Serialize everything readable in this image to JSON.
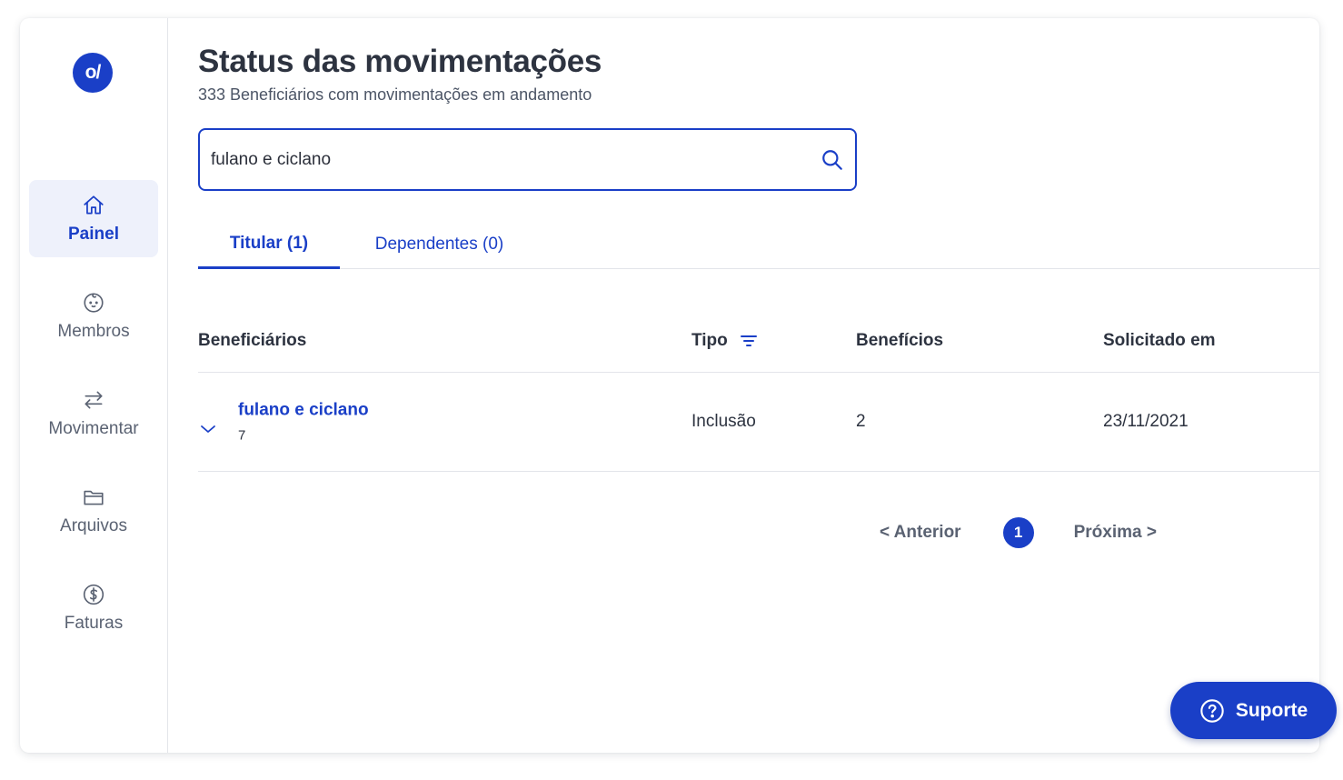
{
  "sidebar": {
    "logo_text": "o/",
    "items": [
      {
        "label": "Painel",
        "icon": "home-icon",
        "active": true
      },
      {
        "label": "Membros",
        "icon": "baby-face-icon",
        "active": false
      },
      {
        "label": "Movimentar",
        "icon": "swap-arrows-icon",
        "active": false
      },
      {
        "label": "Arquivos",
        "icon": "folder-icon",
        "active": false
      },
      {
        "label": "Faturas",
        "icon": "dollar-circle-icon",
        "active": false
      }
    ]
  },
  "header": {
    "title": "Status das movimentações",
    "subtitle": "333 Beneficiários com movimentações em andamento"
  },
  "search": {
    "value": "fulano e ciclano",
    "icon": "search-icon"
  },
  "tabs": [
    {
      "label": "Titular (1)",
      "active": true
    },
    {
      "label": "Dependentes (0)",
      "active": false
    }
  ],
  "table": {
    "headers": {
      "beneficiarios": "Beneficiários",
      "tipo": "Tipo",
      "beneficios": "Benefícios",
      "solicitado": "Solicitado em"
    },
    "rows": [
      {
        "name": "fulano e ciclano",
        "sub": "7",
        "tipo": "Inclusão",
        "beneficios": "2",
        "solicitado": "23/11/2021"
      }
    ]
  },
  "pagination": {
    "prev": "< Anterior",
    "current": "1",
    "next": "Próxima >"
  },
  "support": {
    "label": "Suporte",
    "icon": "help-circle-icon"
  },
  "colors": {
    "accent": "#1a3fc7",
    "text": "#2d3340",
    "muted": "#5a6272"
  }
}
